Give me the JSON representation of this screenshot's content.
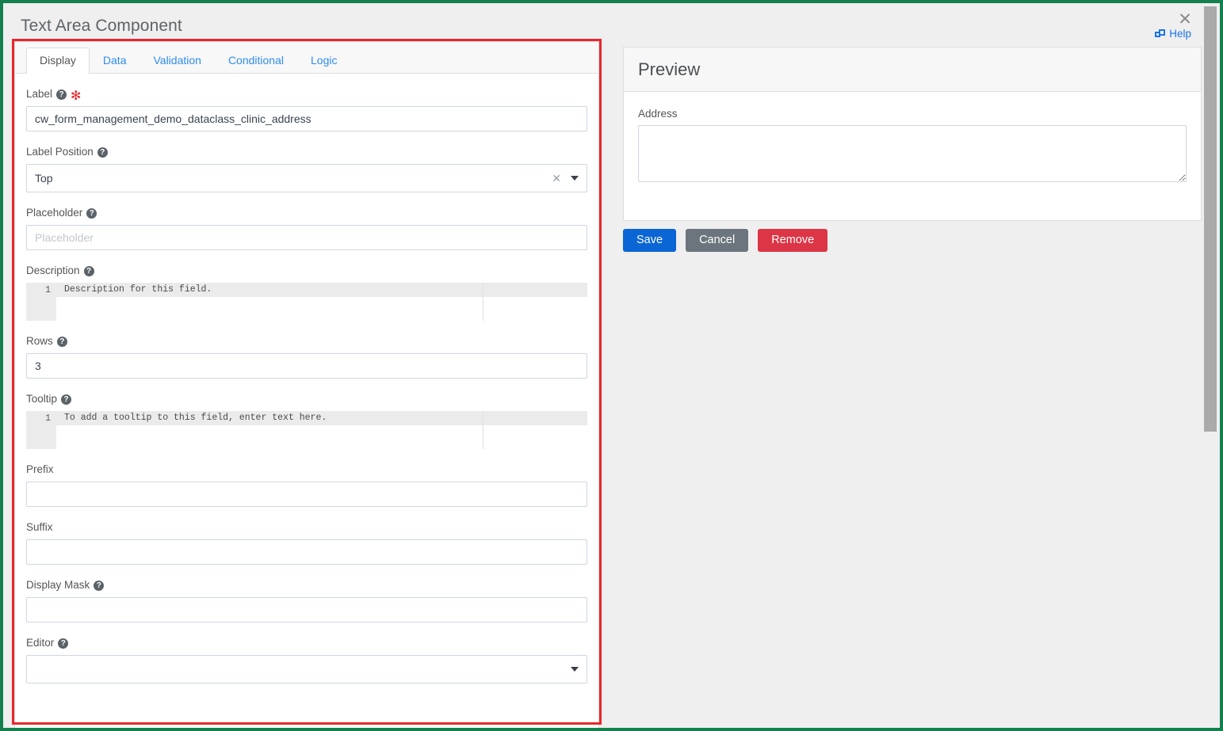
{
  "dialog": {
    "title": "Text Area Component",
    "close_label": "✕",
    "help_label": "Help",
    "help_icon": "external-window-icon"
  },
  "tabs": [
    {
      "label": "Display",
      "active": true
    },
    {
      "label": "Data",
      "active": false
    },
    {
      "label": "Validation",
      "active": false
    },
    {
      "label": "Conditional",
      "active": false
    },
    {
      "label": "Logic",
      "active": false
    }
  ],
  "form": {
    "label": {
      "label": "Label",
      "help_icon": "question-mark-icon",
      "required_marker": "✻",
      "value": "cw_form_management_demo_dataclass_clinic_address"
    },
    "label_position": {
      "label": "Label Position",
      "help_icon": "question-mark-icon",
      "value": "Top",
      "clear_icon": "✕",
      "caret_icon": "chevron-down-icon"
    },
    "placeholder": {
      "label": "Placeholder",
      "help_icon": "question-mark-icon",
      "value": "",
      "placeholder": "Placeholder"
    },
    "description": {
      "label": "Description",
      "help_icon": "question-mark-icon",
      "line_number": "1",
      "value": "Description for this field."
    },
    "rows": {
      "label": "Rows",
      "help_icon": "question-mark-icon",
      "value": "3"
    },
    "tooltip": {
      "label": "Tooltip",
      "help_icon": "question-mark-icon",
      "line_number": "1",
      "value": "To add a tooltip to this field, enter text here."
    },
    "prefix": {
      "label": "Prefix",
      "value": ""
    },
    "suffix": {
      "label": "Suffix",
      "value": ""
    },
    "display_mask": {
      "label": "Display Mask",
      "help_icon": "question-mark-icon",
      "value": ""
    },
    "editor": {
      "label": "Editor",
      "help_icon": "question-mark-icon",
      "value": "",
      "caret_icon": "chevron-down-icon"
    }
  },
  "preview": {
    "title": "Preview",
    "field_label": "Address",
    "field_value": ""
  },
  "actions": {
    "save": "Save",
    "cancel": "Cancel",
    "remove": "Remove"
  },
  "colors": {
    "annotation_outer": "#13804e",
    "annotation_inner": "#e8262d",
    "link": "#2d8cf0",
    "save": "#0a66d4",
    "cancel": "#6c757d",
    "remove": "#dc3545",
    "required": "#e8262d"
  }
}
